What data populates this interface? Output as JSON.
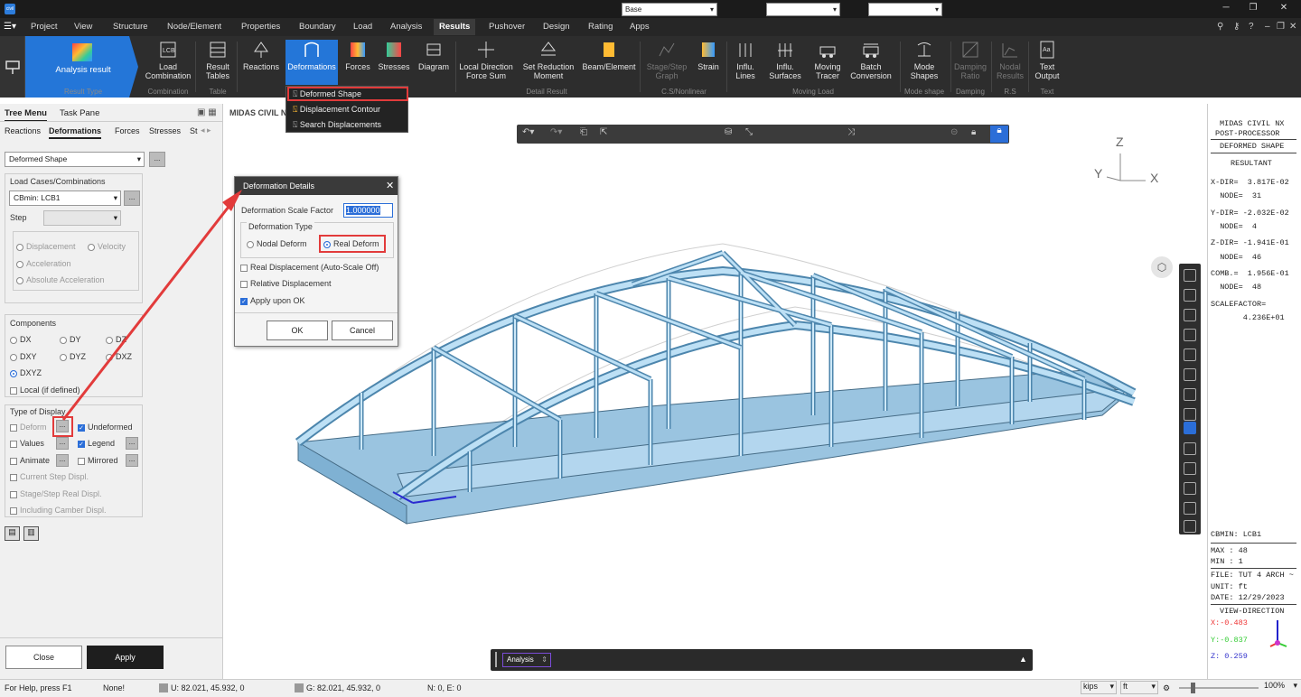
{
  "app": {
    "menu_items": [
      "Project",
      "View",
      "Structure",
      "Node/Element",
      "Properties",
      "Boundary",
      "Load",
      "Analysis",
      "Results",
      "Pushover",
      "Design",
      "Rating",
      "Apps"
    ],
    "active_menu": "Results",
    "logo_text": "civil"
  },
  "ribbon": {
    "analysis_result": "Analysis result",
    "result_type": "Result Type",
    "load_combination": [
      "Load",
      "Combination"
    ],
    "combination": "Combination",
    "result_tables": [
      "Result",
      "Tables"
    ],
    "table": "Table",
    "reactions": "Reactions",
    "deformations": "Deformations",
    "forces": "Forces",
    "stresses": "Stresses",
    "diagram": "Diagram",
    "local_direction": [
      "Local Direction",
      "Force Sum"
    ],
    "set_reduction": [
      "Set Reduction",
      "Moment"
    ],
    "beam_element": "Beam/Element",
    "detail_result": "Detail Result",
    "stage_step": [
      "Stage/Step",
      "Graph"
    ],
    "strain": "Strain",
    "cs_nonlinear": "C.S/Nonlinear",
    "influ_lines": [
      "Influ.",
      "Lines"
    ],
    "influ_surfaces": [
      "Influ.",
      "Surfaces"
    ],
    "moving_tracer": [
      "Moving",
      "Tracer"
    ],
    "batch_conversion": [
      "Batch",
      "Conversion"
    ],
    "moving_load": "Moving Load",
    "mode_shapes": [
      "Mode",
      "Shapes"
    ],
    "mode_shape": "Mode shape",
    "damping_ratio": [
      "Damping",
      "Ratio"
    ],
    "damping": "Damping",
    "nodal_results": [
      "Nodal",
      "Results"
    ],
    "rs": "R.S",
    "text_output": [
      "Text",
      "Output"
    ],
    "text": "Text"
  },
  "dropdown": [
    "Deformed Shape",
    "Displacement Contour",
    "Search Displacements"
  ],
  "left_panel": {
    "tabs": [
      "Tree Menu",
      "Task Pane"
    ],
    "subtabs": [
      "Reactions",
      "Deformations",
      "Forces",
      "Stresses",
      "St"
    ],
    "type_select": "Deformed Shape",
    "load_cases_label": "Load Cases/Combinations",
    "load_case": "CBmin: LCB1",
    "step_label": "Step",
    "options": [
      "Displacement",
      "Velocity",
      "Acceleration",
      "Absolute Acceleration"
    ],
    "components_label": "Components",
    "components": [
      "DX",
      "DY",
      "DZ",
      "DXY",
      "DYZ",
      "DXZ",
      "DXYZ"
    ],
    "local_label": "Local (if defined)",
    "type_of_display": "Type of Display",
    "deform": "Deform",
    "undeformed": "Undeformed",
    "values": "Values",
    "legend": "Legend",
    "animate": "Animate",
    "mirrored": "Mirrored",
    "current_step": "Current Step Displ.",
    "stage_step_real": "Stage/Step Real Displ.",
    "including_camber": "Including Camber Displ.",
    "dots": "...",
    "close": "Close",
    "apply": "Apply"
  },
  "viewport": {
    "title": "MIDAS CIVIL N",
    "base": "Base",
    "axis": {
      "z": "Z",
      "y": "Y",
      "x": "X"
    }
  },
  "dialog": {
    "title": "Deformation Details",
    "scale_label": "Deformation Scale Factor",
    "scale_value": "1.000000",
    "type_label": "Deformation Type",
    "nodal": "Nodal Deform",
    "real": "Real Deform",
    "real_displ": "Real Displacement (Auto-Scale Off)",
    "relative": "Relative Displacement",
    "apply_ok": "Apply upon OK",
    "ok": "OK",
    "cancel": "Cancel"
  },
  "info": {
    "header": [
      "MIDAS CIVIL NX",
      "POST-PROCESSOR"
    ],
    "deformed_shape": "DEFORMED SHAPE",
    "resultant": "RESULTANT",
    "lines": [
      "X-DIR=  3.817E-02",
      "  NODE=  31",
      "Y-DIR= -2.032E-02",
      "  NODE=  4",
      "Z-DIR= -1.941E-01",
      "  NODE=  46",
      "COMB.=  1.956E-01",
      "  NODE=  48",
      "SCALEFACTOR=",
      "       4.236E+01"
    ],
    "cbmin": "CBMIN: LCB1",
    "max": "MAX : 48",
    "min": "MIN : 1",
    "file": "FILE: TUT 4 ARCH ~",
    "unit": "UNIT: ft",
    "date": "DATE: 12/29/2023",
    "view_dir": "VIEW-DIRECTION",
    "vx": "X:-0.483",
    "vy": "Y:-0.837",
    "vz": "Z: 0.259"
  },
  "analysis_bar": "Analysis",
  "status": {
    "help": "For Help, press F1",
    "none": "None!",
    "u": "U: 82.021, 45.932, 0",
    "g": "G: 82.021, 45.932, 0",
    "ne": "N: 0, E: 0",
    "force_unit": "kips",
    "length_unit": "ft",
    "zoom": "100%"
  }
}
